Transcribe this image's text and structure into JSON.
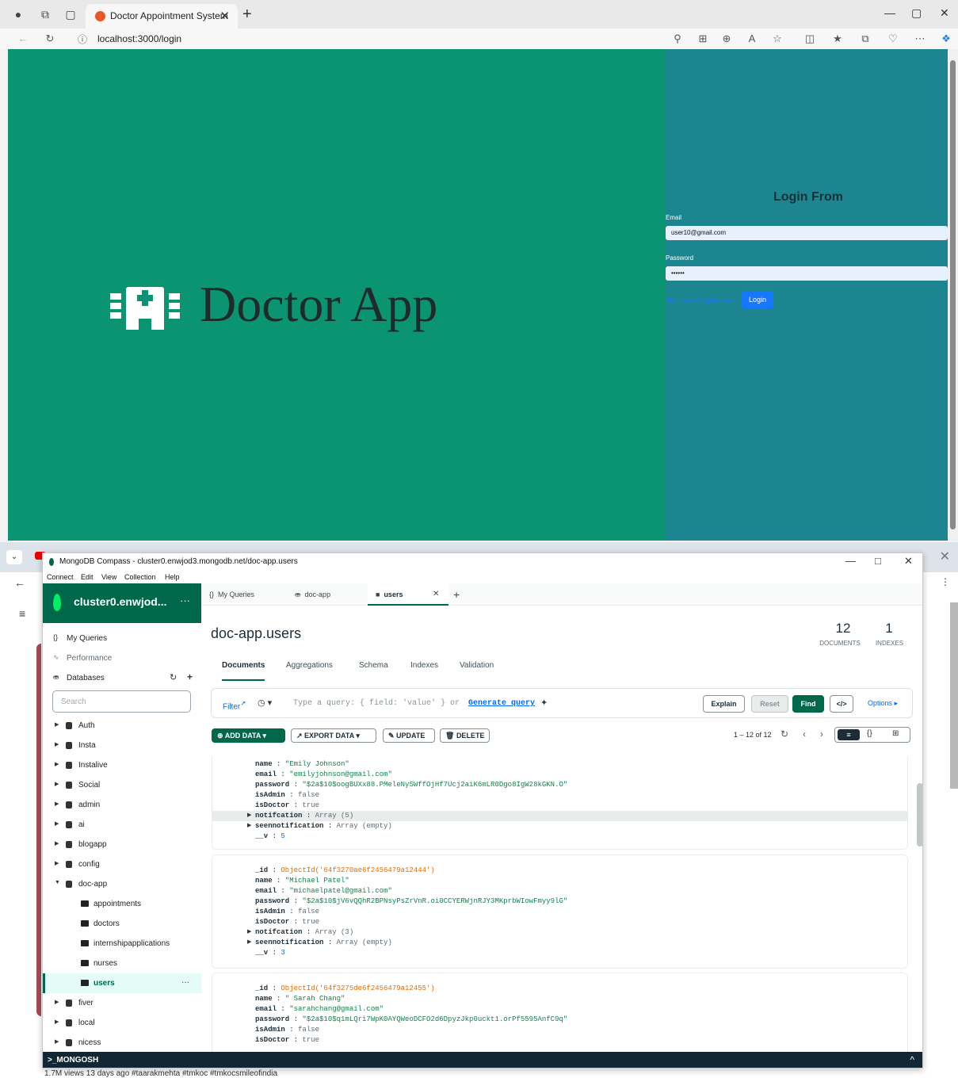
{
  "browser_top": {
    "tab_title": "Doctor Appointment System",
    "url": "localhost:3000/login",
    "new_tab": "+",
    "close": "✕",
    "win_min": "—",
    "win_max": "▢",
    "win_close": "✕"
  },
  "login_page": {
    "logo_text": "Doctor App",
    "form_title": "Login From",
    "email_label": "Email",
    "email_value": "user10@gmail.com",
    "password_label": "Password",
    "password_value": "••••••",
    "register_link": "Not a user Register here",
    "login_button": "Login"
  },
  "back_browser": {
    "footer": "1.7M views  13 days ago  #taarakmehta #tmkoc #tmkocsmileofindia"
  },
  "compass": {
    "window_title": "MongoDB Compass - cluster0.enwjod3.mongodb.net/doc-app.users",
    "menu": [
      "Connect",
      "Edit",
      "View",
      "Collection",
      "Help"
    ],
    "cluster_name": "cluster0.enwjod...",
    "cluster_more": "···",
    "sidebar": {
      "my_queries": "My Queries",
      "performance": "Performance",
      "databases": "Databases",
      "search_placeholder": "Search",
      "databases_list": [
        "Auth",
        "Insta",
        "Instalive",
        "Social",
        "admin",
        "ai",
        "blogapp",
        "config",
        "doc-app"
      ],
      "collections": [
        "appointments",
        "doctors",
        "internshipapplications",
        "nurses",
        "users"
      ],
      "databases_after": [
        "fiver",
        "local",
        "nicess"
      ],
      "users_more": "···"
    },
    "tabs": {
      "my_queries": "My Queries",
      "doc_app": "doc-app",
      "users": "users",
      "close": "✕",
      "add": "+"
    },
    "namespace": "doc-app.users",
    "stats": {
      "documents_count": "12",
      "documents_label": "DOCUMENTS",
      "indexes_count": "1",
      "indexes_label": "INDEXES"
    },
    "sub_tabs": [
      "Documents",
      "Aggregations",
      "Schema",
      "Indexes",
      "Validation"
    ],
    "query": {
      "filter_label": "Filter",
      "placeholder": "Type a query: { field: 'value' } or",
      "generate": "Generate query",
      "explain": "Explain",
      "reset": "Reset",
      "find": "Find",
      "code": "</>",
      "options": "Options ▸"
    },
    "actions": {
      "add_data": "ADD DATA",
      "export_data": "EXPORT DATA",
      "update": "UPDATE",
      "delete": "DELETE",
      "pager": "1 – 12 of 12"
    },
    "documents": [
      {
        "name": "\"Emily Johnson\"",
        "email": "\"emilyjohnson@gmail.com\"",
        "password": "\"$2a$10$oogBUXx88.PMeleNySWffOjHf7Ucj2aiK6mLR0Dgo8IgW28kGKN.O\"",
        "isAdmin": "false",
        "isDoctor": "true",
        "notifcation": "Array (5)",
        "seennotification": "Array (empty)",
        "__v": "5"
      },
      {
        "_id": "ObjectId('64f3270ae6f2456479a12444')",
        "name": "\"Michael Patel\"",
        "email": "\"michaelpatel@gmail.com\"",
        "password": "\"$2a$10$jV6vQQhR2BPNsyPsZrVnR.oi0CCYERWjnRJY3MKprbWIowFmyy9lG\"",
        "isAdmin": "false",
        "isDoctor": "true",
        "notifcation": "Array (3)",
        "seennotification": "Array (empty)",
        "__v": "3"
      },
      {
        "_id": "ObjectId('64f3275de6f2456479a12455')",
        "name": "\" Sarah Chang\"",
        "email": "\"sarahchang@gmail.com\"",
        "password": "\"$2a$10$q1mLQri7WpK0AYQWeoDCFO2d6DpyzJkp0uckt1.orPf5595AnfC9q\"",
        "isAdmin": "false",
        "isDoctor": "true"
      }
    ],
    "mongosh": ">_MONGOSH",
    "mongosh_caret": "^"
  }
}
